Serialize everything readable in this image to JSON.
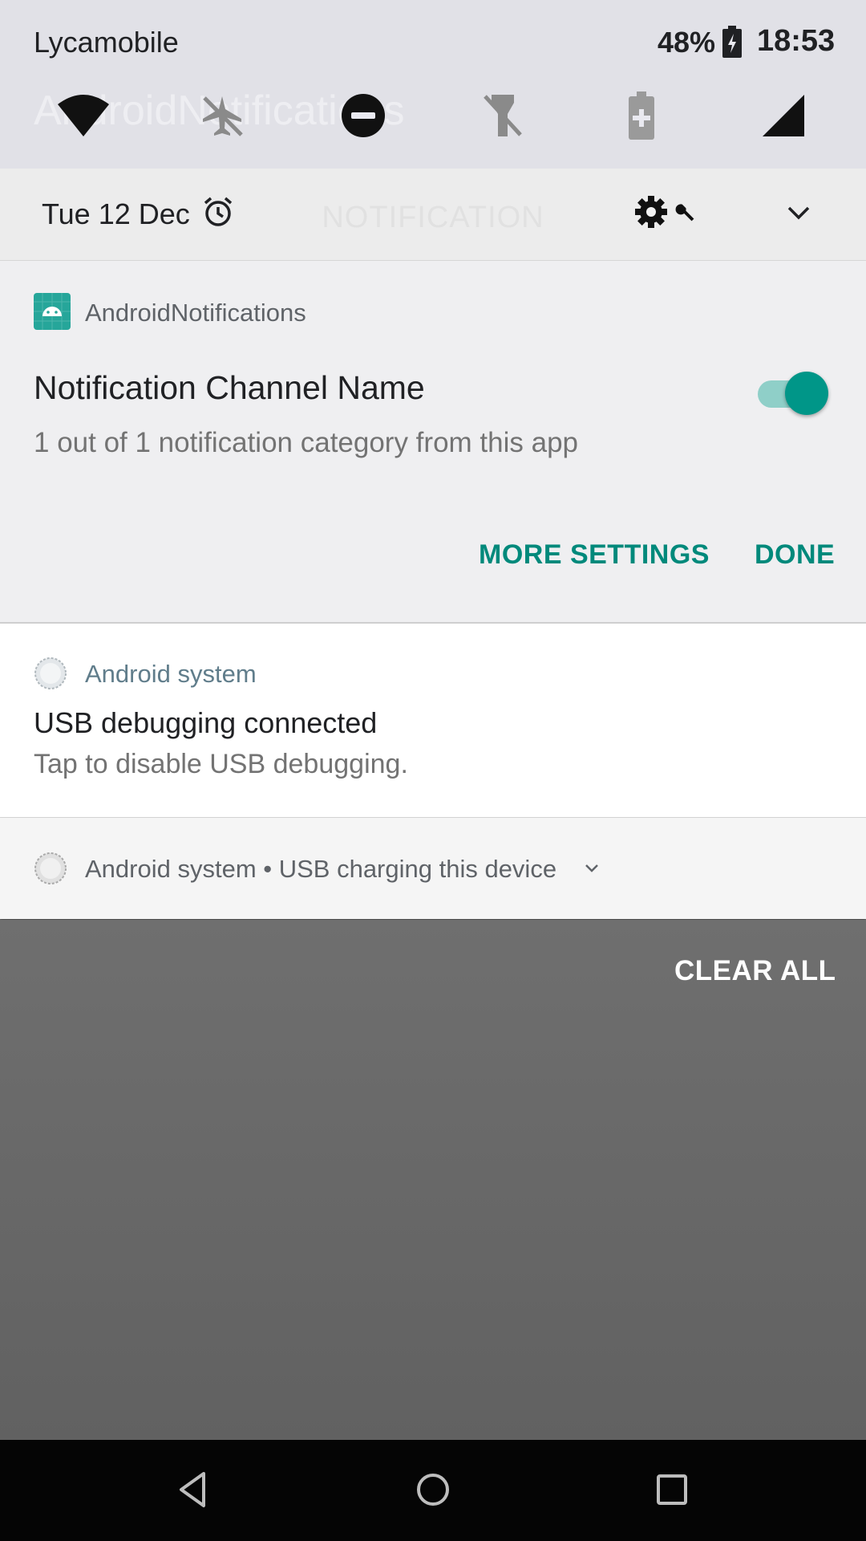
{
  "background": {
    "app_title_ghost": "AndroidNotifications",
    "tab_ghost": "NOTIFICATION"
  },
  "status_bar": {
    "carrier": "Lycamobile",
    "battery_percent": "48%",
    "time": "18:53"
  },
  "quick_settings": {
    "tiles": [
      {
        "icon": "wifi-icon",
        "active": true
      },
      {
        "icon": "airplane-mode-off-icon",
        "active": false
      },
      {
        "icon": "do-not-disturb-icon",
        "active": true
      },
      {
        "icon": "flashlight-off-icon",
        "active": false
      },
      {
        "icon": "battery-saver-icon",
        "active": false
      },
      {
        "icon": "cellular-signal-icon",
        "active": true
      }
    ],
    "date": "Tue 12 Dec"
  },
  "channel_card": {
    "app_name": "AndroidNotifications",
    "channel_name": "Notification Channel Name",
    "description": "1 out of 1 notification category from this app",
    "toggle_on": true,
    "more_settings_label": "MORE SETTINGS",
    "done_label": "DONE"
  },
  "notifications": [
    {
      "app": "Android system",
      "title": "USB debugging connected",
      "text": "Tap to disable USB debugging."
    },
    {
      "summary": "Android system • USB charging this device"
    }
  ],
  "clear_all_label": "CLEAR ALL",
  "colors": {
    "accent": "#009688",
    "accent_text": "#00897b",
    "app_icon_bg": "#26a69a"
  }
}
